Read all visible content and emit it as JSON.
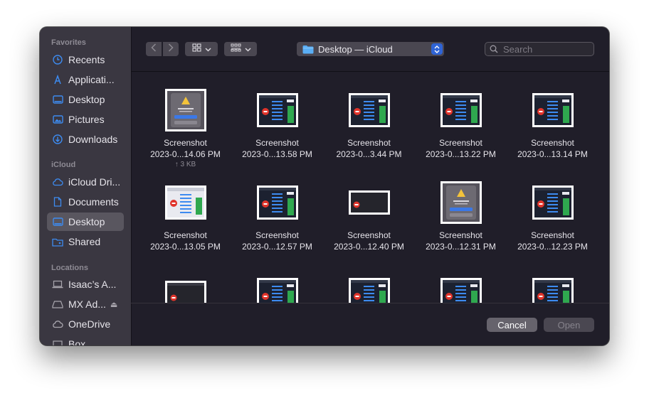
{
  "sidebar": {
    "favorites_title": "Favorites",
    "favorites": [
      {
        "label": "Recents",
        "icon": "clock-icon"
      },
      {
        "label": "Applicati...",
        "icon": "applications-icon"
      },
      {
        "label": "Desktop",
        "icon": "desktop-icon"
      },
      {
        "label": "Pictures",
        "icon": "pictures-icon"
      },
      {
        "label": "Downloads",
        "icon": "download-icon"
      }
    ],
    "icloud_title": "iCloud",
    "icloud": [
      {
        "label": "iCloud Dri...",
        "icon": "cloud-icon"
      },
      {
        "label": "Documents",
        "icon": "document-icon"
      },
      {
        "label": "Desktop",
        "icon": "desktop-icon",
        "selected": true
      },
      {
        "label": "Shared",
        "icon": "shared-folder-icon"
      }
    ],
    "locations_title": "Locations",
    "locations": [
      {
        "label": "Isaac’s A...",
        "icon": "laptop-icon"
      },
      {
        "label": "MX Ad...",
        "icon": "drive-icon",
        "eject": "⏏"
      },
      {
        "label": "OneDrive",
        "icon": "cloud-icon"
      },
      {
        "label": "Box",
        "icon": "box-icon"
      }
    ]
  },
  "toolbar": {
    "location": "Desktop — iCloud",
    "search_placeholder": "Search"
  },
  "files": [
    {
      "line1": "Screenshot",
      "line2": "2023-0...14.06 PM",
      "size": "↑ 3 KB",
      "thumb": "dialog"
    },
    {
      "line1": "Screenshot",
      "line2": "2023-0...13.58 PM",
      "thumb": "app"
    },
    {
      "line1": "Screenshot",
      "line2": "2023-0...3.44 PM",
      "thumb": "app"
    },
    {
      "line1": "Screenshot",
      "line2": "2023-0...13.22 PM",
      "thumb": "app"
    },
    {
      "line1": "Screenshot",
      "line2": "2023-0...13.14 PM",
      "thumb": "app"
    },
    {
      "line1": "Screenshot",
      "line2": "2023-0...13.05 PM",
      "thumb": "light"
    },
    {
      "line1": "Screenshot",
      "line2": "2023-0...12.57 PM",
      "thumb": "app"
    },
    {
      "line1": "Screenshot",
      "line2": "2023-0...12.40 PM",
      "thumb": "wide"
    },
    {
      "line1": "Screenshot",
      "line2": "2023-0...12.31 PM",
      "thumb": "dialog"
    },
    {
      "line1": "Screenshot",
      "line2": "2023-0...12.23 PM",
      "thumb": "app"
    },
    {
      "line1": "",
      "line2": "",
      "thumb": "dark"
    },
    {
      "line1": "",
      "line2": "",
      "thumb": "app"
    },
    {
      "line1": "",
      "line2": "",
      "thumb": "app"
    },
    {
      "line1": "",
      "line2": "",
      "thumb": "app"
    },
    {
      "line1": "",
      "line2": "",
      "thumb": "app"
    }
  ],
  "footer": {
    "cancel": "Cancel",
    "open": "Open"
  },
  "colors": {
    "accent": "#2f64d6",
    "window_bg": "#201e29",
    "sidebar_bg": "#3a3741",
    "selection": "#59565f"
  }
}
